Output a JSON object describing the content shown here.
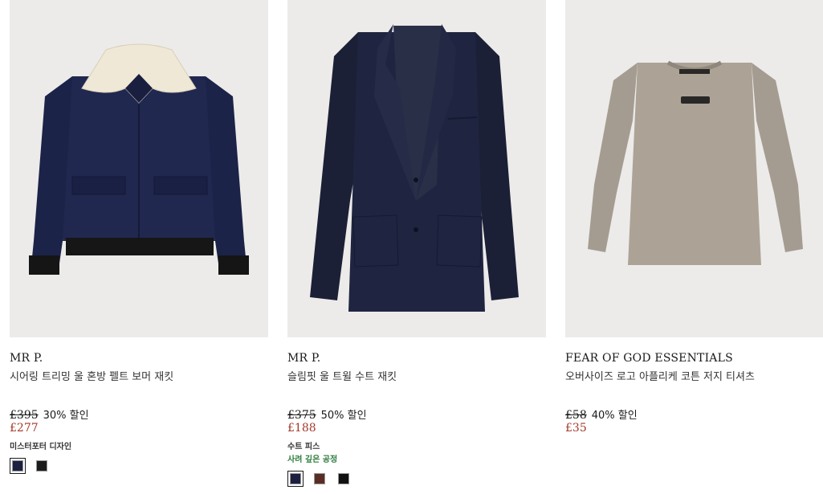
{
  "products": [
    {
      "brand": "MR P.",
      "name": "시어링 트리밍 울 혼방 펠트 보머 재킷",
      "original_price": "£395",
      "discount": "30% 할인",
      "sale_price": "£277",
      "tags": [
        "미스터포터 디자인"
      ],
      "swatches": [
        {
          "color": "#1b2040",
          "selected": true
        },
        {
          "color": "#1c1c1c",
          "selected": false
        }
      ]
    },
    {
      "brand": "MR P.",
      "name": "슬림핏 울 트윌 수트 재킷",
      "original_price": "£375",
      "discount": "50% 할인",
      "sale_price": "£188",
      "tags": [
        "수트 피스",
        "사려 깊은 공정"
      ],
      "swatches": [
        {
          "color": "#1b2040",
          "selected": true
        },
        {
          "color": "#5a2d24",
          "selected": false
        },
        {
          "color": "#111111",
          "selected": false
        }
      ]
    },
    {
      "brand": "FEAR OF GOD ESSENTIALS",
      "name": "오버사이즈 로고 아플리케 코튼 저지 티셔츠",
      "original_price": "£58",
      "discount": "40% 할인",
      "sale_price": "£35",
      "tags": [],
      "swatches": []
    }
  ]
}
